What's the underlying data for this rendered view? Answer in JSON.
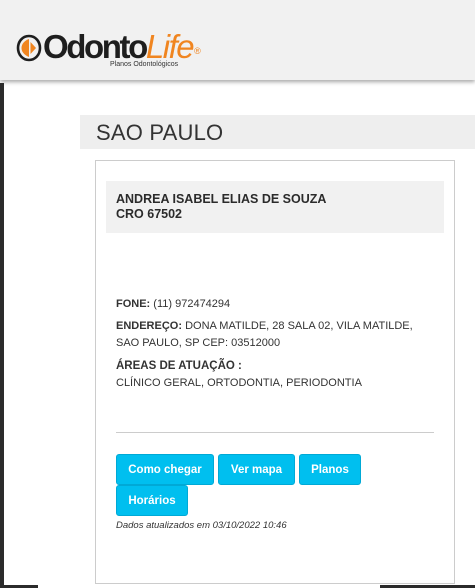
{
  "header": {
    "logo_word1": "Odonto",
    "logo_word2": "Life",
    "logo_registered": "®",
    "logo_tagline": "Planos Odontológicos",
    "brand_orange": "#f08520"
  },
  "city": {
    "title": "SAO PAULO"
  },
  "dentist": {
    "name": "ANDREA ISABEL ELIAS DE SOUZA",
    "cro": "CRO 67502",
    "phone_label": "FONE:",
    "phone": "(11) 972474294",
    "address_label": "ENDEREÇO:",
    "address": "DONA MATILDE, 28 SALA 02, VILA MATILDE, SAO PAULO, SP CEP: 03512000",
    "areas_label": "ÁREAS DE ATUAÇÃO :",
    "areas": "CLÍNICO GERAL, ORTODONTIA, PERIODONTIA"
  },
  "actions": {
    "como_chegar": "Como chegar",
    "ver_mapa": "Ver mapa",
    "planos": "Planos",
    "horarios": "Horários",
    "button_color": "#00bfef"
  },
  "footer": {
    "updated": "Dados atualizados em 03/10/2022 10:46"
  }
}
